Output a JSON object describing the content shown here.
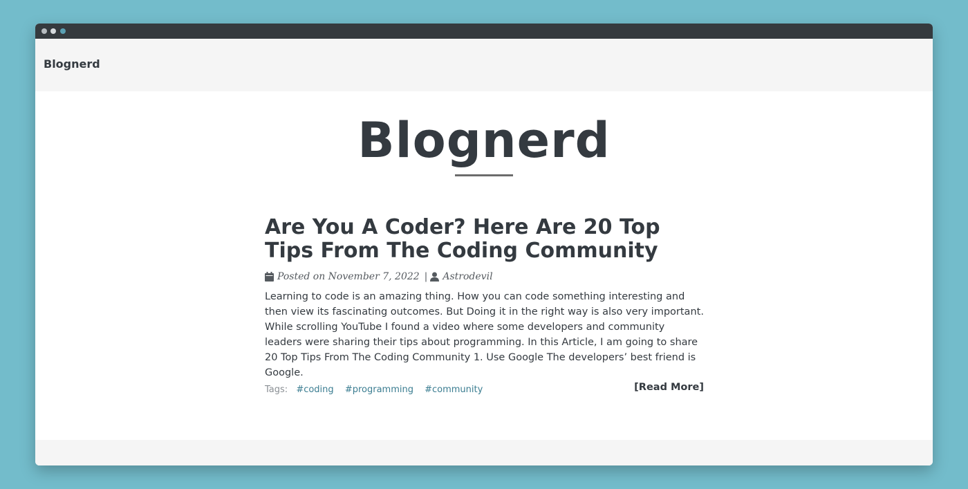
{
  "navbar": {
    "brand": "Blognerd"
  },
  "header": {
    "title": "Blognerd"
  },
  "post": {
    "title": "Are You A Coder? Here Are 20 Top Tips From The Coding Community",
    "date": "Posted on November 7, 2022",
    "separator": "|",
    "author": "Astrodevil",
    "excerpt": "Learning to code is an amazing thing. How you can code something interesting and then view its fascinating outcomes. But Doing it in the right way is also very important. While scrolling YouTube I found a video where some developers and community leaders were sharing their tips about programming. In this Article, I am going to share 20 Top Tips From The Coding Community 1. Use Google The developers’ best friend is Google.",
    "tags_label": "Tags:",
    "tags": [
      "#coding",
      "#programming",
      "#community"
    ],
    "read_more": "[Read More]"
  },
  "icons": {
    "date": "calendar-icon",
    "author": "user-icon"
  },
  "colors": {
    "background": "#73bccb",
    "titlebar": "#353a3e",
    "text": "#343a40",
    "tag_link": "#3b7d91"
  }
}
